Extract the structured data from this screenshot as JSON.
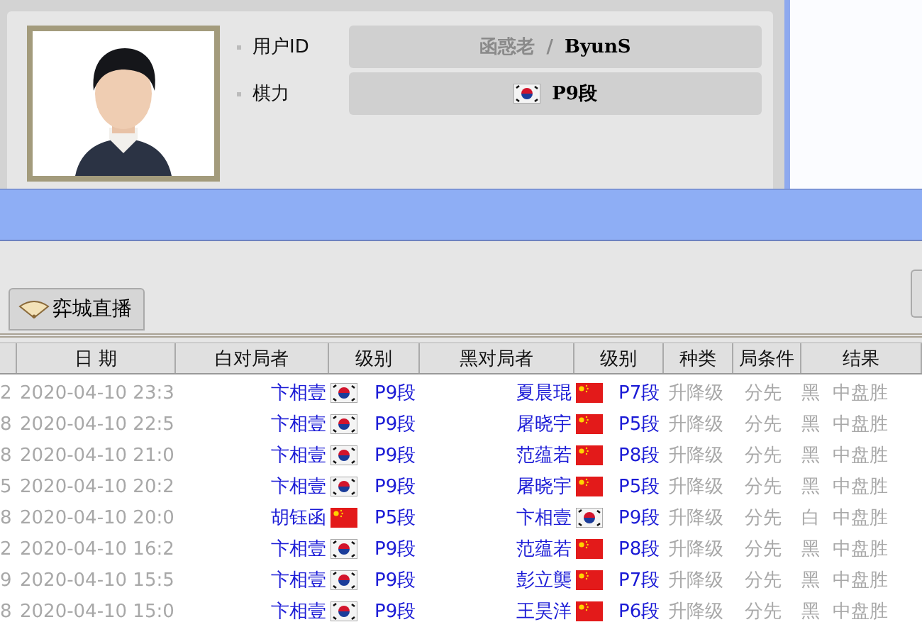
{
  "profile": {
    "fields": [
      {
        "label": "用户ID",
        "value_primary": "函惑老",
        "separator": "/",
        "value_secondary": "ByunS"
      },
      {
        "label": "棋力",
        "flag": {
          "kind": "kr"
        },
        "value_secondary": "P9段"
      }
    ]
  },
  "tabs": [
    {
      "label": "弈城直播",
      "selected": true
    }
  ],
  "table": {
    "columns": [
      "日 期",
      "白对局者",
      "级别",
      "黑对局者",
      "级别",
      "种类",
      "局条件",
      "结果"
    ],
    "rows": [
      {
        "column_1": "2",
        "date": "2020-04-10 23:3",
        "white": "卞相壹",
        "white_flag": {
          "kind": "kr"
        },
        "white_rank": "P9段",
        "black": "夏晨琨",
        "black_flag": {
          "kind": "cn"
        },
        "black_rank": "P7段",
        "type": "升降级",
        "condition": "分先",
        "winner": "黑",
        "result": "中盘胜"
      },
      {
        "column_1": "8",
        "date": "2020-04-10 22:5",
        "white": "卞相壹",
        "white_flag": {
          "kind": "kr"
        },
        "white_rank": "P9段",
        "black": "屠晓宇",
        "black_flag": {
          "kind": "cn"
        },
        "black_rank": "P5段",
        "type": "升降级",
        "condition": "分先",
        "winner": "黑",
        "result": "中盘胜"
      },
      {
        "column_1": "8",
        "date": "2020-04-10 21:0",
        "white": "卞相壹",
        "white_flag": {
          "kind": "kr"
        },
        "white_rank": "P9段",
        "black": "范蕴若",
        "black_flag": {
          "kind": "cn"
        },
        "black_rank": "P8段",
        "type": "升降级",
        "condition": "分先",
        "winner": "黑",
        "result": "中盘胜"
      },
      {
        "column_1": "5",
        "date": "2020-04-10 20:2",
        "white": "卞相壹",
        "white_flag": {
          "kind": "kr"
        },
        "white_rank": "P9段",
        "black": "屠晓宇",
        "black_flag": {
          "kind": "cn"
        },
        "black_rank": "P5段",
        "type": "升降级",
        "condition": "分先",
        "winner": "黑",
        "result": "中盘胜"
      },
      {
        "column_1": "8",
        "date": "2020-04-10 20:0",
        "white": "胡钰函",
        "white_flag": {
          "kind": "cn"
        },
        "white_rank": "P5段",
        "black": "卞相壹",
        "black_flag": {
          "kind": "kr"
        },
        "black_rank": "P9段",
        "type": "升降级",
        "condition": "分先",
        "winner": "白",
        "result": "中盘胜"
      },
      {
        "column_1": "2",
        "date": "2020-04-10 16:2",
        "white": "卞相壹",
        "white_flag": {
          "kind": "kr"
        },
        "white_rank": "P9段",
        "black": "范蕴若",
        "black_flag": {
          "kind": "cn"
        },
        "black_rank": "P8段",
        "type": "升降级",
        "condition": "分先",
        "winner": "黑",
        "result": "中盘胜"
      },
      {
        "column_1": "9",
        "date": "2020-04-10 15:5",
        "white": "卞相壹",
        "white_flag": {
          "kind": "kr"
        },
        "white_rank": "P9段",
        "black": "彭立龑",
        "black_flag": {
          "kind": "cn"
        },
        "black_rank": "P7段",
        "type": "升降级",
        "condition": "分先",
        "winner": "黑",
        "result": "中盘胜"
      },
      {
        "column_1": "8",
        "date": "2020-04-10 15:0",
        "white": "卞相壹",
        "white_flag": {
          "kind": "kr"
        },
        "white_rank": "P9段",
        "black": "王昊洋",
        "black_flag": {
          "kind": "cn"
        },
        "black_rank": "P6段",
        "type": "升降级",
        "condition": "分先",
        "winner": "黑",
        "result": "中盘胜"
      }
    ]
  }
}
